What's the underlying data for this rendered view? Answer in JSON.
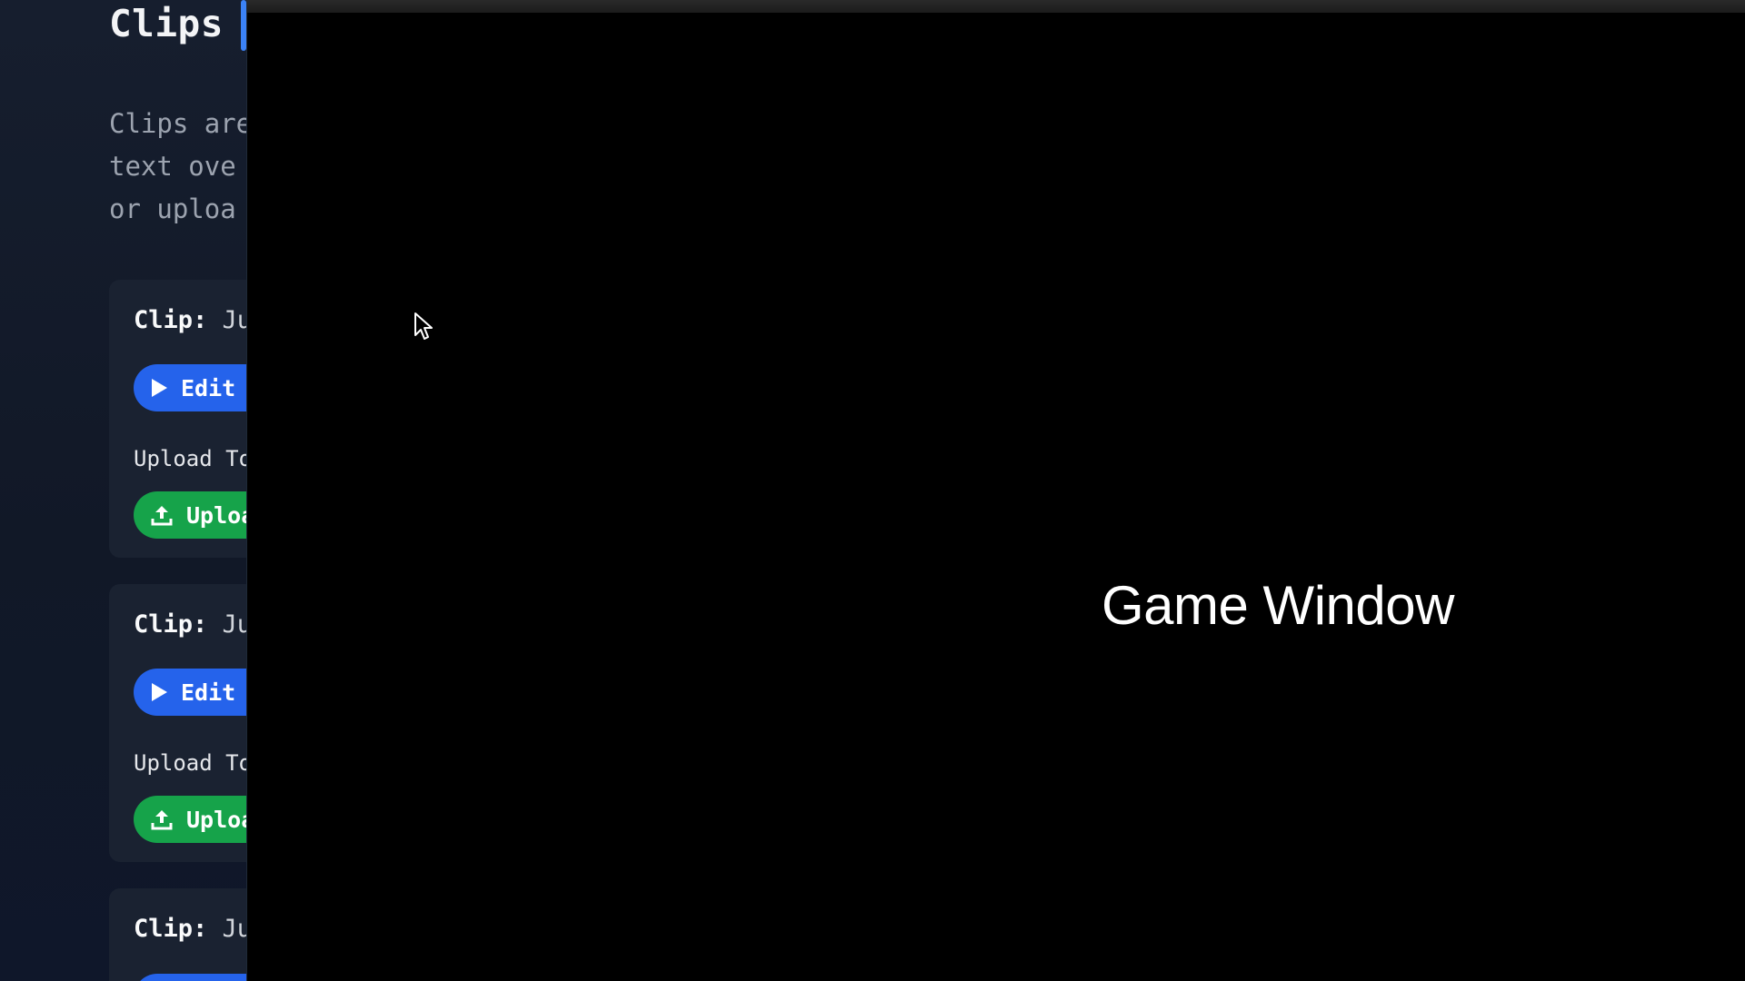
{
  "page": {
    "title": "Clips",
    "description_lines": [
      "Clips are",
      "text ove",
      "or uploa"
    ]
  },
  "clips": [
    {
      "label": "Clip:",
      "name": "Ju",
      "edit_label": "Edit",
      "upload_to_label": "Upload To",
      "upload_button_label": "Uploa"
    },
    {
      "label": "Clip:",
      "name": "Ju",
      "edit_label": "Edit",
      "upload_to_label": "Upload To",
      "upload_button_label": "Uploa"
    },
    {
      "label": "Clip:",
      "name": "Ju"
    }
  ],
  "game_window": {
    "label": "Game Window"
  },
  "colors": {
    "accent_blue": "#2563eb",
    "upload_green": "#16a34a",
    "background": "#111827",
    "game_window_bg": "#000000"
  },
  "icons": {
    "edit": "play-icon",
    "upload": "upload-icon",
    "cursor": "mouse-cursor-icon"
  }
}
